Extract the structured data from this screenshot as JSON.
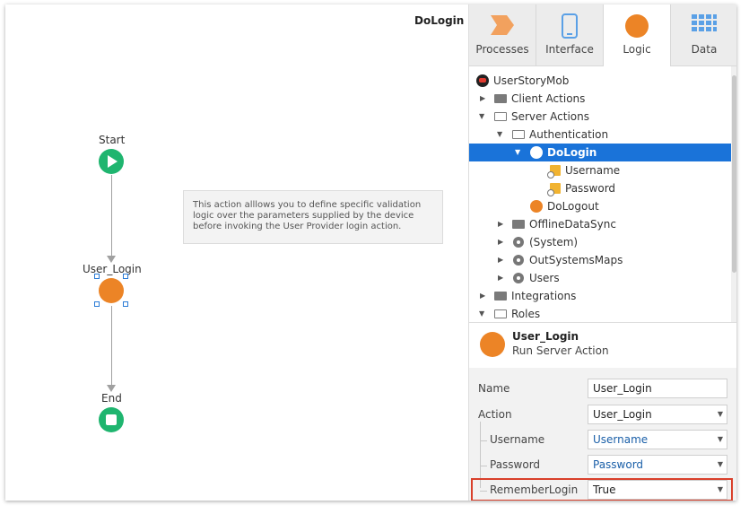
{
  "canvas": {
    "title": "DoLogin",
    "start_label": "Start",
    "action_label": "User_Login",
    "end_label": "End",
    "comment": "This action alllows you to define specific validation logic over the parameters supplied by the device before invoking the User Provider login action."
  },
  "tabs": [
    {
      "label": "Processes",
      "icon": "processes-icon"
    },
    {
      "label": "Interface",
      "icon": "interface-icon"
    },
    {
      "label": "Logic",
      "icon": "logic-icon",
      "active": true
    },
    {
      "label": "Data",
      "icon": "data-icon"
    }
  ],
  "tree": {
    "root": "UserStoryMob",
    "client_actions": "Client Actions",
    "server_actions": "Server Actions",
    "authentication": "Authentication",
    "dologin": "DoLogin",
    "username": "Username",
    "password": "Password",
    "dologout": "DoLogout",
    "offline": "OfflineDataSync",
    "system": "(System)",
    "maps": "OutSystemsMaps",
    "users": "Users",
    "integrations": "Integrations",
    "roles": "Roles"
  },
  "summary": {
    "name": "User_Login",
    "type": "Run Server Action"
  },
  "properties": {
    "name_label": "Name",
    "name_value": "User_Login",
    "action_label": "Action",
    "action_value": "User_Login",
    "username_label": "Username",
    "username_value": "Username",
    "password_label": "Password",
    "password_value": "Password",
    "remember_label": "RememberLogin",
    "remember_value": "True"
  },
  "colors": {
    "start_end": "#1fb56f",
    "action": "#ec8426",
    "selection": "#1a73d9",
    "highlight": "#d9402b"
  }
}
